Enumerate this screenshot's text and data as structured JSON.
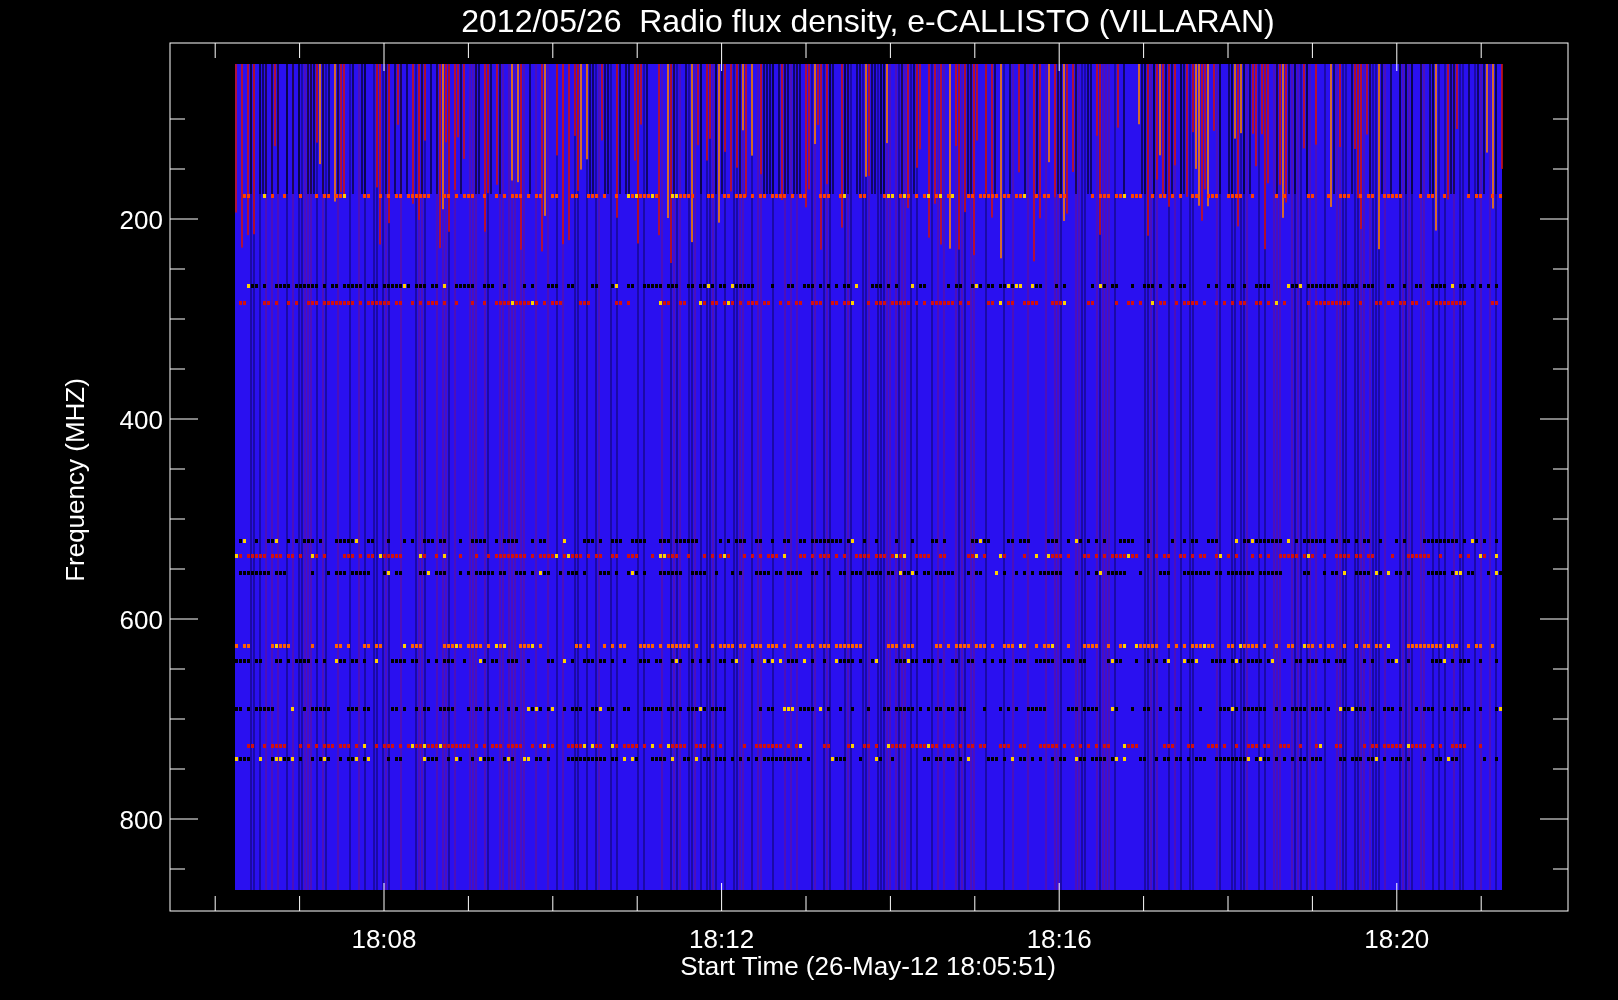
{
  "plot": {
    "title": "2012/05/26  Radio flux density, e-CALLISTO (VILLARAN)",
    "ylabel": "Frequency (MHZ)",
    "xlabel": "Start Time (26-May-12 18:05:51)",
    "yticks": [
      "200",
      "400",
      "600",
      "800"
    ],
    "xticks": [
      "18:08",
      "18:12",
      "18:16",
      "18:20"
    ]
  }
}
